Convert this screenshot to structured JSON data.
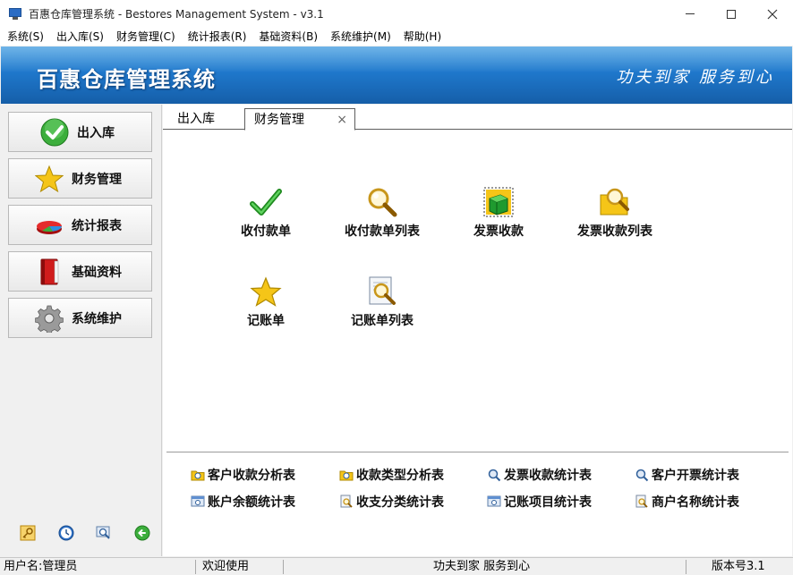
{
  "window": {
    "title": "百惠仓库管理系统 - Bestores Management System - v3.1",
    "min_icon": "minimize-icon",
    "max_icon": "maximize-icon",
    "close_icon": "close-icon",
    "close_glyph": "✕"
  },
  "menu": [
    {
      "label": "系统(S)"
    },
    {
      "label": "出入库(S)"
    },
    {
      "label": "财务管理(C)"
    },
    {
      "label": "统计报表(R)"
    },
    {
      "label": "基础资料(B)"
    },
    {
      "label": "系统维护(M)"
    },
    {
      "label": "帮助(H)"
    }
  ],
  "banner": {
    "title": "百惠仓库管理系统",
    "slogan": "功夫到家 服务到心"
  },
  "sidebar": {
    "items": [
      {
        "label": "出入库",
        "icon": "green-check-icon"
      },
      {
        "label": "财务管理",
        "icon": "star-icon"
      },
      {
        "label": "统计报表",
        "icon": "pie-chart-icon"
      },
      {
        "label": "基础资料",
        "icon": "red-book-icon"
      },
      {
        "label": "系统维护",
        "icon": "gear-icon"
      }
    ],
    "bottom_icons": [
      "key-icon",
      "clock-icon",
      "magnifier-icon",
      "green-back-arrow-icon"
    ]
  },
  "tabs": [
    {
      "label": "出入库",
      "active": false
    },
    {
      "label": "财务管理",
      "active": true,
      "close": "×"
    }
  ],
  "features": [
    {
      "label": "收付款单",
      "icon": "green-check-icon"
    },
    {
      "label": "收付款单列表",
      "icon": "magnifier-icon"
    },
    {
      "label": "发票收款",
      "icon": "green-cube-icon"
    },
    {
      "label": "发票收款列表",
      "icon": "folder-search-icon"
    },
    {
      "label": "记账单",
      "icon": "star-icon"
    },
    {
      "label": "记账单列表",
      "icon": "document-search-icon"
    }
  ],
  "reports": [
    {
      "label": "客户收款分析表",
      "icon": "folder-search-icon"
    },
    {
      "label": "收款类型分析表",
      "icon": "folder-search-icon"
    },
    {
      "label": "发票收款统计表",
      "icon": "magnifier-icon"
    },
    {
      "label": "客户开票统计表",
      "icon": "magnifier-icon"
    },
    {
      "label": "账户余额统计表",
      "icon": "window-search-icon"
    },
    {
      "label": "收支分类统计表",
      "icon": "document-search-icon"
    },
    {
      "label": "记账项目统计表",
      "icon": "window-search-icon"
    },
    {
      "label": "商户名称统计表",
      "icon": "document-search-icon"
    }
  ],
  "status": {
    "user": "用户名:管理员",
    "welcome": "欢迎使用",
    "slogan": "功夫到家 服务到心",
    "version": "版本号3.1"
  },
  "colors": {
    "banner_top": "#3f9be0",
    "banner_bottom": "#155ea8",
    "check_green": "#2e9d2e",
    "star_yellow": "#f5c518"
  }
}
